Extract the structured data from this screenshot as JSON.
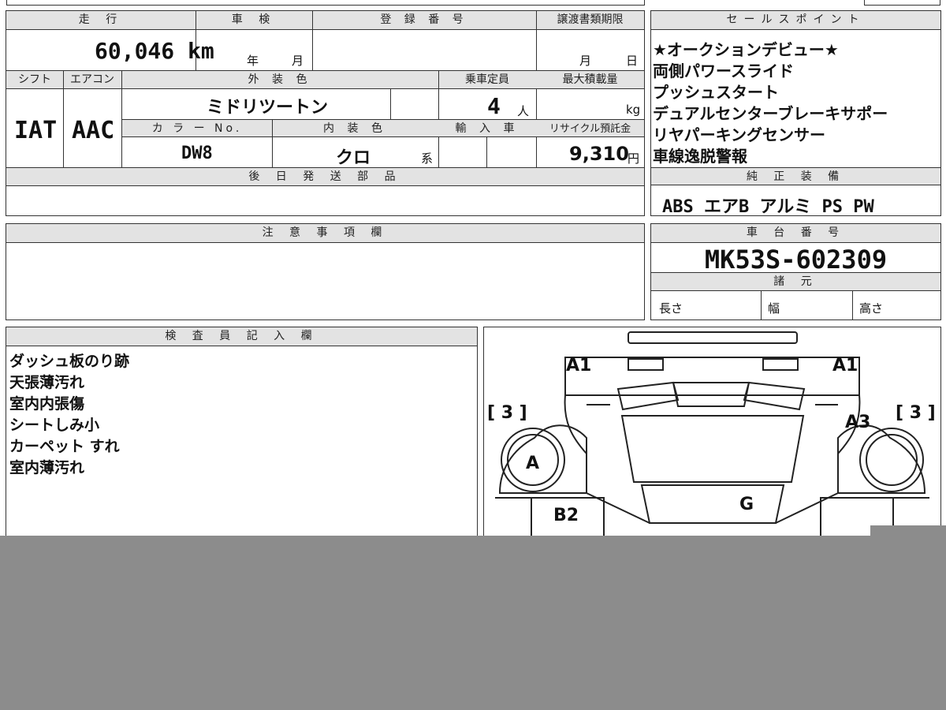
{
  "vehicle": {
    "labels": {
      "mileage": "走 行",
      "inspection": "車 検",
      "registration": "登 録 番 号",
      "transfer_deadline": "譲渡書類期限",
      "shift": "シフト",
      "aircon": "エアコン",
      "exterior_color": "外 装 色",
      "capacity": "乗車定員",
      "max_load": "最大積載量",
      "color_no": "カ ラ ー No.",
      "interior_color": "内 装 色",
      "import": "輸 入 車",
      "recycle_fee": "リサイクル預託金",
      "later_parts": "後 日 発 送 部 品"
    },
    "mileage": "60,046 km",
    "year_unit": "年",
    "month_unit": "月",
    "day_unit": "日",
    "shift": "IAT",
    "aircon": "AAC",
    "exterior_color": "ミドリツートン",
    "capacity": "4",
    "capacity_unit": "人",
    "load_unit": "kg",
    "color_no": "DW8",
    "interior_color": "クロ",
    "interior_suffix": "系",
    "recycle_fee": "9,310",
    "recycle_unit": "円"
  },
  "sales_points": {
    "title": "セールスポイント",
    "items": [
      "★オークションデビュー★",
      "両側パワースライド",
      "プッシュスタート",
      "デュアルセンターブレーキサポー",
      "リヤパーキングセンサー",
      "車線逸脱警報"
    ]
  },
  "genuine_equipment": {
    "title": "純 正 装 備",
    "value": "ABS エアB アルミ PS PW"
  },
  "notes": {
    "title": "注 意 事 項 欄"
  },
  "chassis": {
    "title": "車 台 番 号",
    "value": "MK53S-602309",
    "spec_title": "諸 元",
    "length": "長さ",
    "width": "幅",
    "height": "高さ"
  },
  "inspector": {
    "title": "検 査 員 記 入 欄",
    "items": [
      "ダッシュ板のり跡",
      "天張薄汚れ",
      "室内内張傷",
      "シートしみ小",
      "カーペット すれ",
      "室内薄汚れ"
    ]
  },
  "diagram": {
    "marks": {
      "a1_left": "A1",
      "a1_right": "A1",
      "a3": "A3",
      "a": "A",
      "b2": "B2",
      "g": "G",
      "grade_left": "[ 3 ]",
      "grade_right": "[ 3 ]"
    }
  },
  "colors": {
    "header_bg": "#e3e3e3",
    "overlay_gray": "#8c8c8c"
  }
}
